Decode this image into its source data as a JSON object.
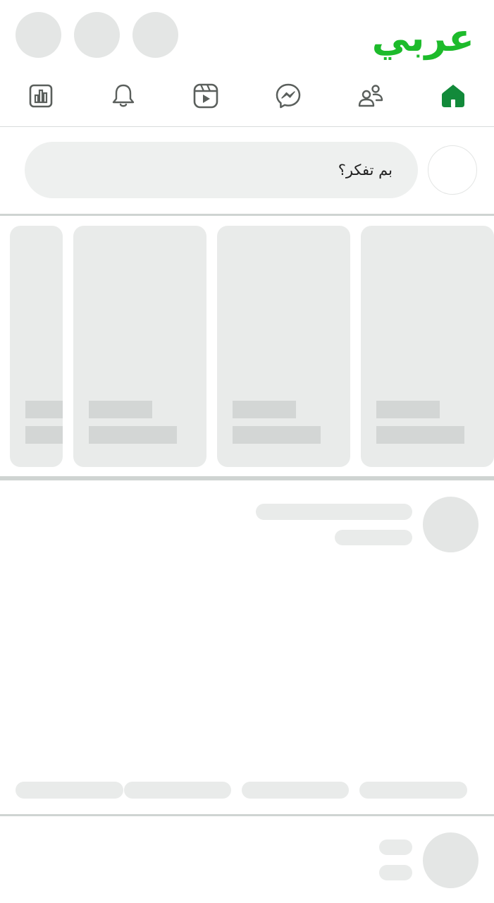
{
  "header": {
    "logo_text": "عربي",
    "brand_color": "#1dbb2b",
    "placeholder_circles": 3
  },
  "nav": {
    "items": [
      {
        "name": "dashboard",
        "icon": "bar-chart-icon"
      },
      {
        "name": "notifications",
        "icon": "bell-icon"
      },
      {
        "name": "reels",
        "icon": "video-play-icon"
      },
      {
        "name": "messenger",
        "icon": "messenger-icon"
      },
      {
        "name": "friends",
        "icon": "friends-icon"
      },
      {
        "name": "home",
        "icon": "home-icon",
        "active": true
      }
    ],
    "active_color": "#128a3a",
    "icon_color": "#5a5f5c"
  },
  "composer": {
    "placeholder": "بم تفكر؟"
  },
  "colors": {
    "skeleton": "#e4e6e5",
    "skeleton_bar": "#d3d6d5",
    "divider": "#cfd4d2"
  }
}
